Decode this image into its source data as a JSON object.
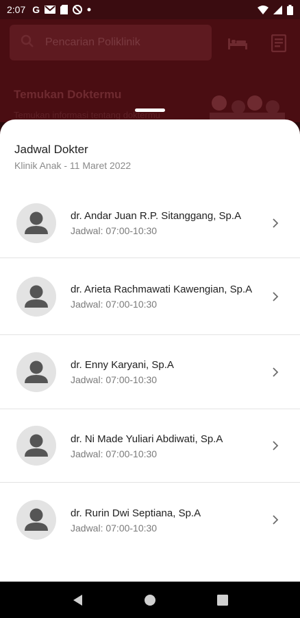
{
  "status_bar": {
    "time": "2:07",
    "left_icons": [
      "google-icon",
      "gmail-icon",
      "sd-card-icon",
      "sync-off-icon",
      "dot-icon"
    ],
    "right_icons": [
      "wifi-icon",
      "signal-icon",
      "battery-icon"
    ]
  },
  "background_app": {
    "search_placeholder": "Pencarian Poliklinik",
    "heading": "Temukan Doktermu",
    "subheading": "Temukan informasi tentang doktermu"
  },
  "sheet": {
    "title": "Jadwal Dokter",
    "subtitle": "Klinik Anak - 11 Maret 2022"
  },
  "doctors": [
    {
      "name": "dr. Andar Juan R.P. Sitanggang, Sp.A",
      "schedule": "Jadwal: 07:00-10:30"
    },
    {
      "name": "dr. Arieta Rachmawati Kawengian, Sp.A",
      "schedule": "Jadwal: 07:00-10:30"
    },
    {
      "name": "dr. Enny Karyani, Sp.A",
      "schedule": "Jadwal: 07:00-10:30"
    },
    {
      "name": "dr. Ni Made Yuliari Abdiwati, Sp.A",
      "schedule": "Jadwal: 07:00-10:30"
    },
    {
      "name": "dr. Rurin Dwi Septiana, Sp.A",
      "schedule": "Jadwal: 07:00-10:30"
    }
  ],
  "colors": {
    "primary": "#8b1a22",
    "avatar_bg": "#e3e3e3",
    "avatar_fg": "#555555",
    "divider": "#e3e3e3"
  }
}
